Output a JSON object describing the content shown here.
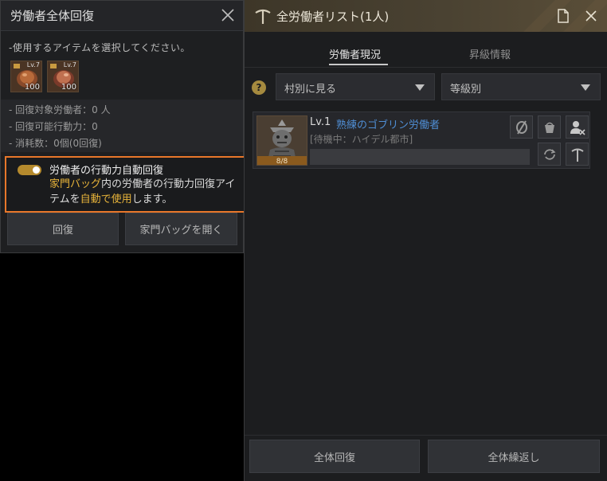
{
  "left_panel": {
    "title": "労働者全体回復",
    "prompt": "-使用するアイテムを選択してください。",
    "items": [
      {
        "count": "100",
        "level": "Lv.7"
      },
      {
        "count": "100",
        "level": "Lv.7"
      }
    ],
    "stats": {
      "target_workers": "- 回復対象労働者：0 人",
      "recoverable_stamina": "- 回復可能行動力：0",
      "consumption": "- 消耗数：0個(0回復)"
    },
    "auto_recover": {
      "enabled": true,
      "title": "労働者の行動力自動回復",
      "desc_part1": "家門バッグ",
      "desc_part2": "内の労働者の行動力回復アイテムを",
      "desc_part3": "自動で使用",
      "desc_part4": "します。"
    },
    "recover_button": "回復",
    "open_bag_button": "家門バッグを開く"
  },
  "right_panel": {
    "title": "全労働者リスト(1人)",
    "tabs": [
      {
        "label": "労働者現況",
        "active": true
      },
      {
        "label": "昇級情報",
        "active": false
      }
    ],
    "filters": {
      "village": "村別に見る",
      "grade": "等級別"
    },
    "worker": {
      "level": "Lv.1",
      "name": "熟練のゴブリン労働者",
      "location": "[待機中：ハイデル都市]",
      "stamina": "8/8"
    },
    "recover_all_button": "全体回復",
    "repeat_all_button": "全体繰返し"
  },
  "colors": {
    "accent": "#e8772a",
    "highlight_text": "#e8b43a",
    "toggle_on": "#b58a2d",
    "worker_name": "#4f8ed4"
  },
  "icons": {
    "left_close": "close-icon",
    "pickaxe": "pickaxe-icon",
    "document": "document-icon",
    "right_close": "close-icon",
    "help": "help-icon",
    "cancel_action": "cancel-action-icon",
    "feed": "feed-icon",
    "fire_worker": "fire-worker-icon",
    "repeat": "repeat-icon",
    "tool": "tool-icon"
  }
}
